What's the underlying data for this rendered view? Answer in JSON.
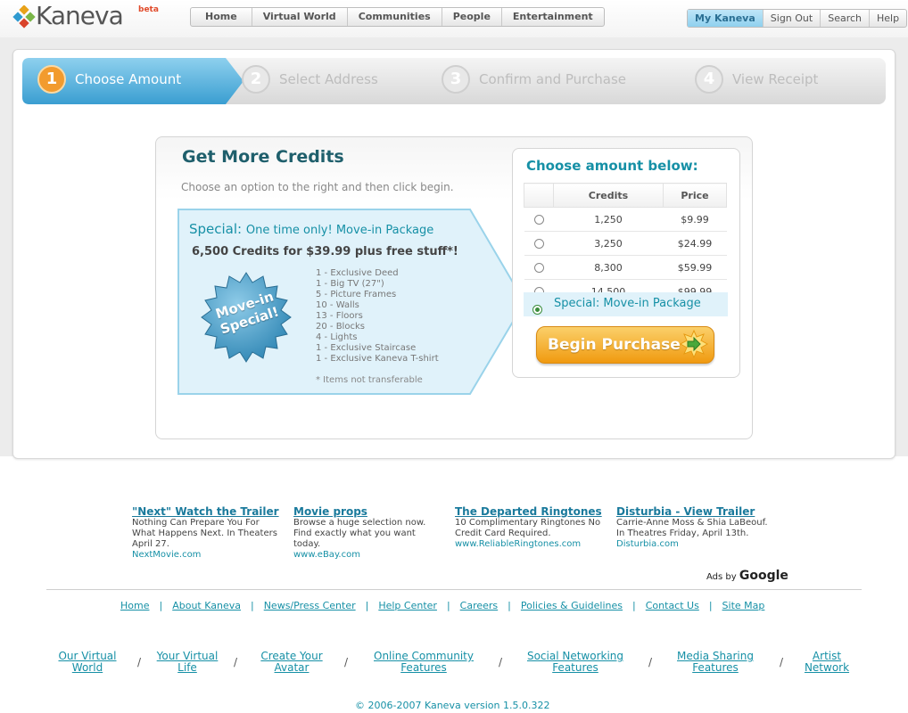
{
  "header": {
    "logo_text": "Kaneva",
    "logo_badge": "beta",
    "main_nav": [
      "Home",
      "Virtual World",
      "Communities",
      "People",
      "Entertainment"
    ],
    "user_nav": [
      "My Kaneva",
      "Sign Out",
      "Search",
      "Help"
    ]
  },
  "steps": [
    {
      "num": "1",
      "label": "Choose Amount"
    },
    {
      "num": "2",
      "label": "Select Address"
    },
    {
      "num": "3",
      "label": "Confirm and Purchase"
    },
    {
      "num": "4",
      "label": "View Receipt"
    }
  ],
  "credits": {
    "title": "Get More Credits",
    "subtitle": "Choose an option to the right and then click begin.",
    "special_prefix": "Special:",
    "special_name": "One time only! Move-in Package",
    "special_offer": "6,500 Credits for $39.99 plus free stuff*!",
    "badge_line1": "Move-in",
    "badge_line2": "Special!",
    "items": [
      "1 - Exclusive Deed",
      "1 - Big TV (27\")",
      "5 - Picture Frames",
      "10 - Walls",
      "13 - Floors",
      "20 - Blocks",
      "4 - Lights",
      "1 - Exclusive Staircase",
      "1 - Exclusive Kaneva T-shirt"
    ],
    "note": "* Items not transferable"
  },
  "choose": {
    "title": "Choose amount below:",
    "col_credits": "Credits",
    "col_price": "Price",
    "rows": [
      {
        "credits": "1,250",
        "price": "$9.99"
      },
      {
        "credits": "3,250",
        "price": "$24.99"
      },
      {
        "credits": "8,300",
        "price": "$59.99"
      },
      {
        "credits": "14,500",
        "price": "$99.99"
      }
    ],
    "special_option": "Special: Move-in Package",
    "button": "Begin Purchase"
  },
  "ads": [
    {
      "title": "\"Next\" Watch the Trailer",
      "body": "Nothing Can Prepare You For What Happens Next. In Theaters April 27.",
      "url": "NextMovie.com"
    },
    {
      "title": "Movie props",
      "body": "Browse a huge selection now. Find exactly what you want today.",
      "url": "www.eBay.com"
    },
    {
      "title": "The Departed Ringtones",
      "body": "10 Complimentary Ringtones No Credit Card Required.",
      "url": "www.ReliableRingtones.com"
    },
    {
      "title": "Disturbia - View Trailer",
      "body": "Carrie-Anne Moss & Shia LaBeouf. In Theatres Friday, April 13th.",
      "url": "Disturbia.com"
    }
  ],
  "ads_by": "Ads by",
  "ads_brand": "Google",
  "footer_links": [
    "Home",
    "About Kaneva",
    "News/Press Center",
    "Help Center",
    "Careers",
    "Policies & Guidelines",
    "Contact Us",
    "Site Map"
  ],
  "footer_links2": [
    [
      "Our Virtual",
      "World"
    ],
    [
      "Your Virtual",
      "Life"
    ],
    [
      "Create Your",
      "Avatar"
    ],
    [
      "Online Community",
      "Features"
    ],
    [
      "Social Networking",
      "Features"
    ],
    [
      "Media Sharing",
      "Features"
    ],
    [
      "Artist",
      "Network"
    ]
  ],
  "copyright": "© 2006-2007 Kaneva version 1.5.0.322",
  "colors": {
    "teal": "#1690a6",
    "step_active": "#3a9ed1",
    "button": "#f09a10"
  }
}
